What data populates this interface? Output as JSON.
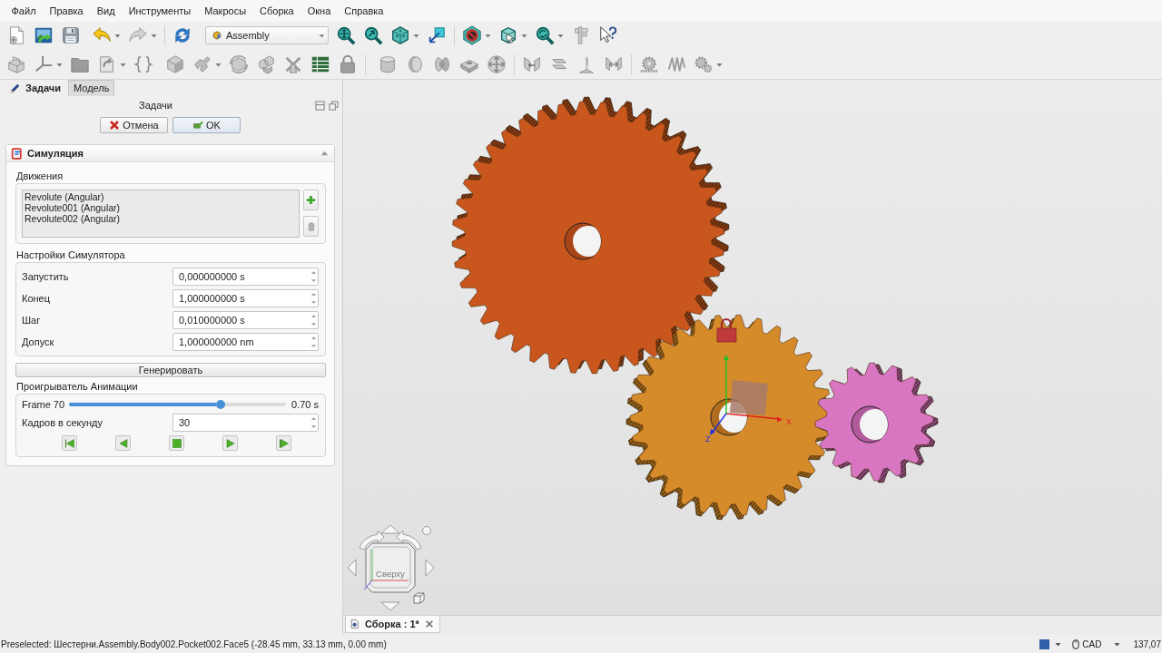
{
  "menu": [
    "Файл",
    "Правка",
    "Вид",
    "Инструменты",
    "Макросы",
    "Сборка",
    "Окна",
    "Справка"
  ],
  "toolbar": {
    "workbench": "Assembly"
  },
  "task_panel": {
    "tabs": [
      {
        "label": "Задачи",
        "selected": true
      },
      {
        "label": "Модель",
        "selected": false
      }
    ],
    "title": "Задачи",
    "buttons": [
      "Отмена",
      "OK"
    ],
    "section": {
      "title": "Симуляция",
      "expanded": true,
      "motions": {
        "label": "Движения",
        "items": [
          "Revolute (Angular)",
          "Revolute001 (Angular)",
          "Revolute002 (Angular)"
        ]
      },
      "settings": {
        "label": "Настройки Симулятора",
        "rows": [
          {
            "label": "Запустить",
            "value": "0,000000000 s"
          },
          {
            "label": "Конец",
            "value": "1,000000000 s"
          },
          {
            "label": "Шаг",
            "value": "0,010000000 s"
          },
          {
            "label": "Допуск",
            "value": "1,000000000 nm"
          }
        ]
      },
      "generate_button": "Генерировать",
      "player": {
        "label": "Проигрыватель Анимации",
        "frame": "Frame 70",
        "level": 0.7,
        "time": "0.70 s",
        "fps_label": "Кадров в секунду",
        "fps": "30"
      }
    }
  },
  "viewport": {
    "axis_labels": [
      "X",
      "Z"
    ],
    "nav_cube_face": "Сверху"
  },
  "document_tabs": [
    {
      "label": "Сборка : 1*",
      "selected": true
    }
  ],
  "status_bar": {
    "message": "Preselected: Шестерни.Assembly.Body002.Pocket002.Face5 (-28.45 mm, 33.13 mm, 0.00 mm)",
    "navigation_style": "CAD",
    "readout": "137,07"
  }
}
